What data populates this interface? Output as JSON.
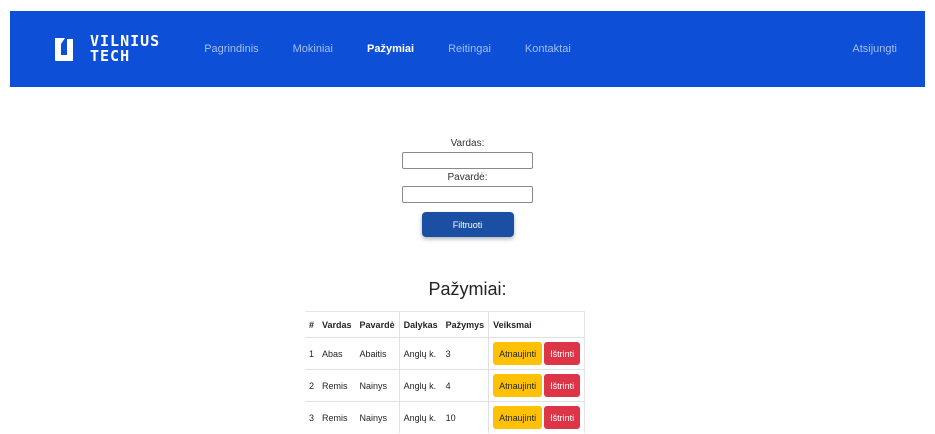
{
  "header": {
    "logo_line1": "VILNIUS",
    "logo_line2": "TECH",
    "nav": [
      {
        "label": "Pagrindinis"
      },
      {
        "label": "Mokiniai"
      },
      {
        "label": "Pažymiai"
      },
      {
        "label": "Reitingai"
      },
      {
        "label": "Kontaktai"
      }
    ],
    "logout_label": "Atsijungti",
    "brand_color": "#0d4fd6"
  },
  "filter": {
    "first_name_label": "Vardas:",
    "first_name_value": "",
    "last_name_label": "Pavardė:",
    "last_name_value": "",
    "button_label": "Filtruoti"
  },
  "grades": {
    "title": "Pažymiai:",
    "columns": [
      "#",
      "Vardas",
      "Pavardė",
      "Dalykas",
      "Pažymys",
      "Veiksmai"
    ],
    "rows": [
      {
        "num": "1",
        "first": "Abas",
        "last": "Abaitis",
        "subject": "Anglų k.",
        "grade": "3",
        "update": "Atnaujinti",
        "delete": "Ištrinti"
      },
      {
        "num": "2",
        "first": "Remis",
        "last": "Nainys",
        "subject": "Anglų k.",
        "grade": "4",
        "update": "Atnaujinti",
        "delete": "Ištrinti"
      },
      {
        "num": "3",
        "first": "Remis",
        "last": "Nainys",
        "subject": "Anglų k.",
        "grade": "10",
        "update": "Atnaujinti",
        "delete": "Ištrinti"
      }
    ]
  }
}
